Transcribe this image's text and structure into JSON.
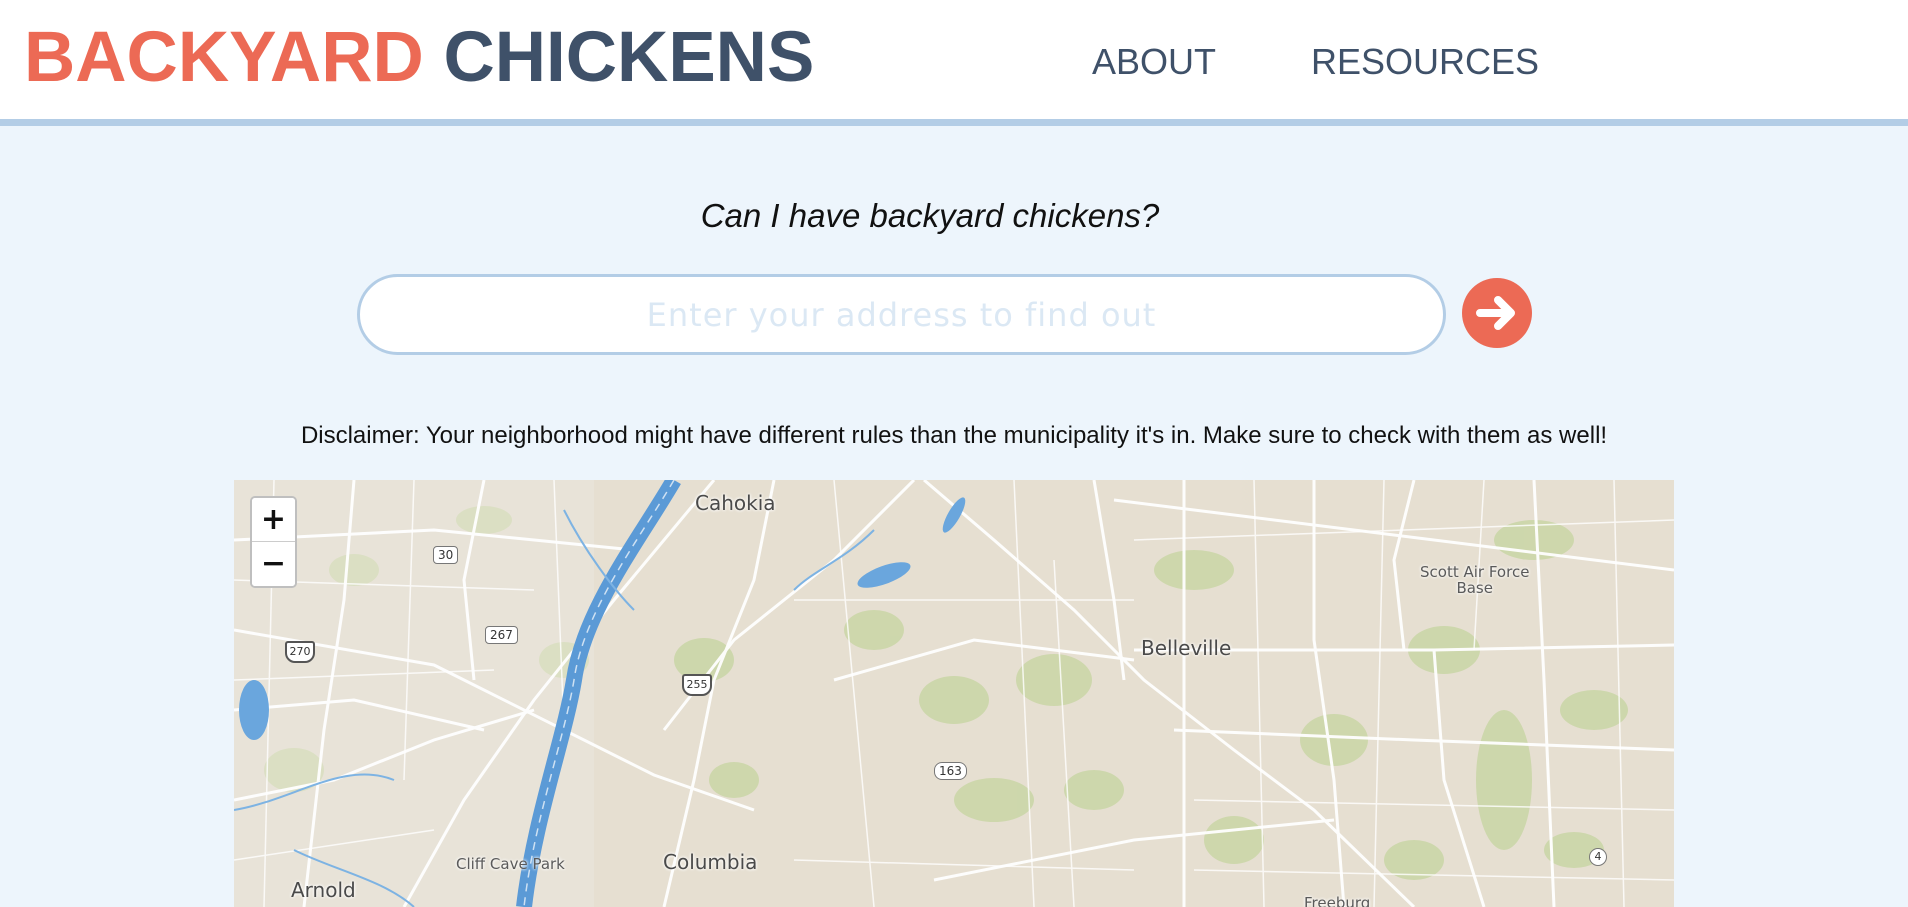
{
  "header": {
    "logo_part1": "BACKYARD",
    "logo_part2": "CHICKENS",
    "nav": [
      "ABOUT",
      "RESOURCES"
    ]
  },
  "colors": {
    "accent": "#ec6a55",
    "navy": "#3f5169",
    "page_bg": "#edf5fc",
    "border_blue": "#b3cde6"
  },
  "main": {
    "question": "Can I have backyard chickens?",
    "search_placeholder": "Enter your address to find out",
    "search_value": "",
    "go_icon": "arrow-right-circle-icon",
    "disclaimer": "Disclaimer: Your neighborhood might have different rules than the municipality it's in. Make sure to check with them as well!"
  },
  "map": {
    "zoom_in": "+",
    "zoom_out": "−",
    "labels": {
      "cahokia": "Cahokia",
      "belleville": "Belleville",
      "scott_afb": "Scott Air Force\nBase",
      "columbia": "Columbia",
      "cliff_cave": "Cliff Cave Park",
      "arnold": "Arnold",
      "freeburg": "Freeburg"
    },
    "route_shields": [
      "30",
      "267",
      "270",
      "255",
      "163",
      "4"
    ]
  }
}
